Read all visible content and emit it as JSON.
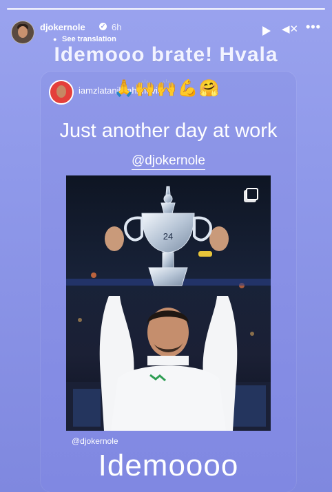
{
  "story": {
    "username": "djokernole",
    "time": "6h",
    "see_translation": "See translation",
    "caption": "Idemooo brate! Hvala"
  },
  "shared_post": {
    "username": "iamzlatanibrahimovic",
    "headline": "Just another day at work",
    "mention": "@djokernole",
    "photo_label": "24",
    "footer_mention": "@djokernole",
    "footer_text": "Idemoooo"
  },
  "icons": [
    "verified-badge-icon",
    "translate-icon",
    "play-icon",
    "mute-icon",
    "more-icon",
    "gallery-icon"
  ],
  "colors": {
    "background": "#8f99ea",
    "text": "#ffffff"
  }
}
